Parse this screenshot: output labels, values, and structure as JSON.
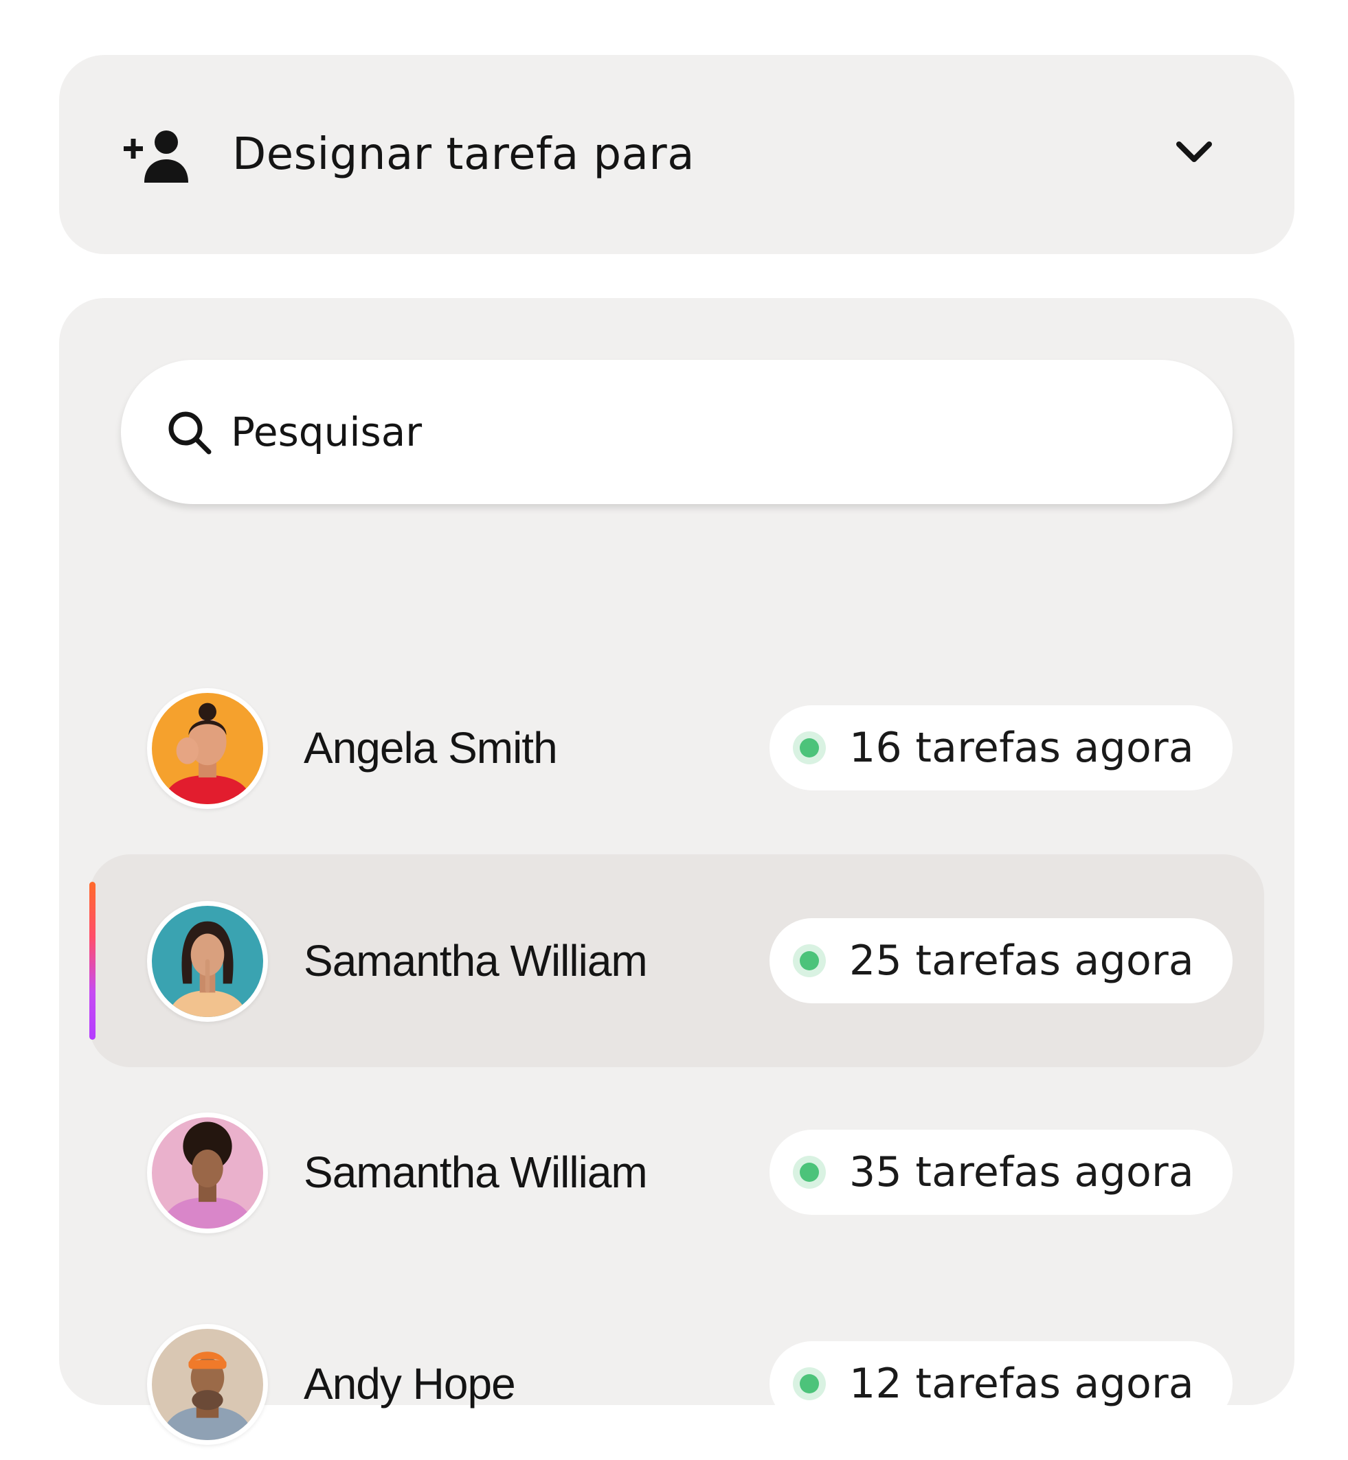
{
  "header": {
    "title": "Designar tarefa para",
    "icon": "person-add-icon",
    "dropdown_icon": "chevron-down-icon"
  },
  "search": {
    "placeholder": "Pesquisar",
    "icon": "search-icon"
  },
  "colors": {
    "status_dot": "#4cc37a",
    "selected_row": "#e8e5e3",
    "accent_gradient": [
      "#ff6a2b",
      "#b43cff"
    ]
  },
  "users": [
    {
      "name": "Angela Smith",
      "tasks": "16 tarefas agora",
      "selected": false,
      "avatar_bg": "#f5a12d"
    },
    {
      "name": "Samantha William",
      "tasks": "25 tarefas agora",
      "selected": true,
      "avatar_bg": "#3aa3b1"
    },
    {
      "name": "Samantha William",
      "tasks": "35 tarefas agora",
      "selected": false,
      "avatar_bg": "#eab1cc"
    },
    {
      "name": "Andy Hope",
      "tasks": "12 tarefas agora",
      "selected": false,
      "avatar_bg": "#d9c7b3"
    }
  ]
}
